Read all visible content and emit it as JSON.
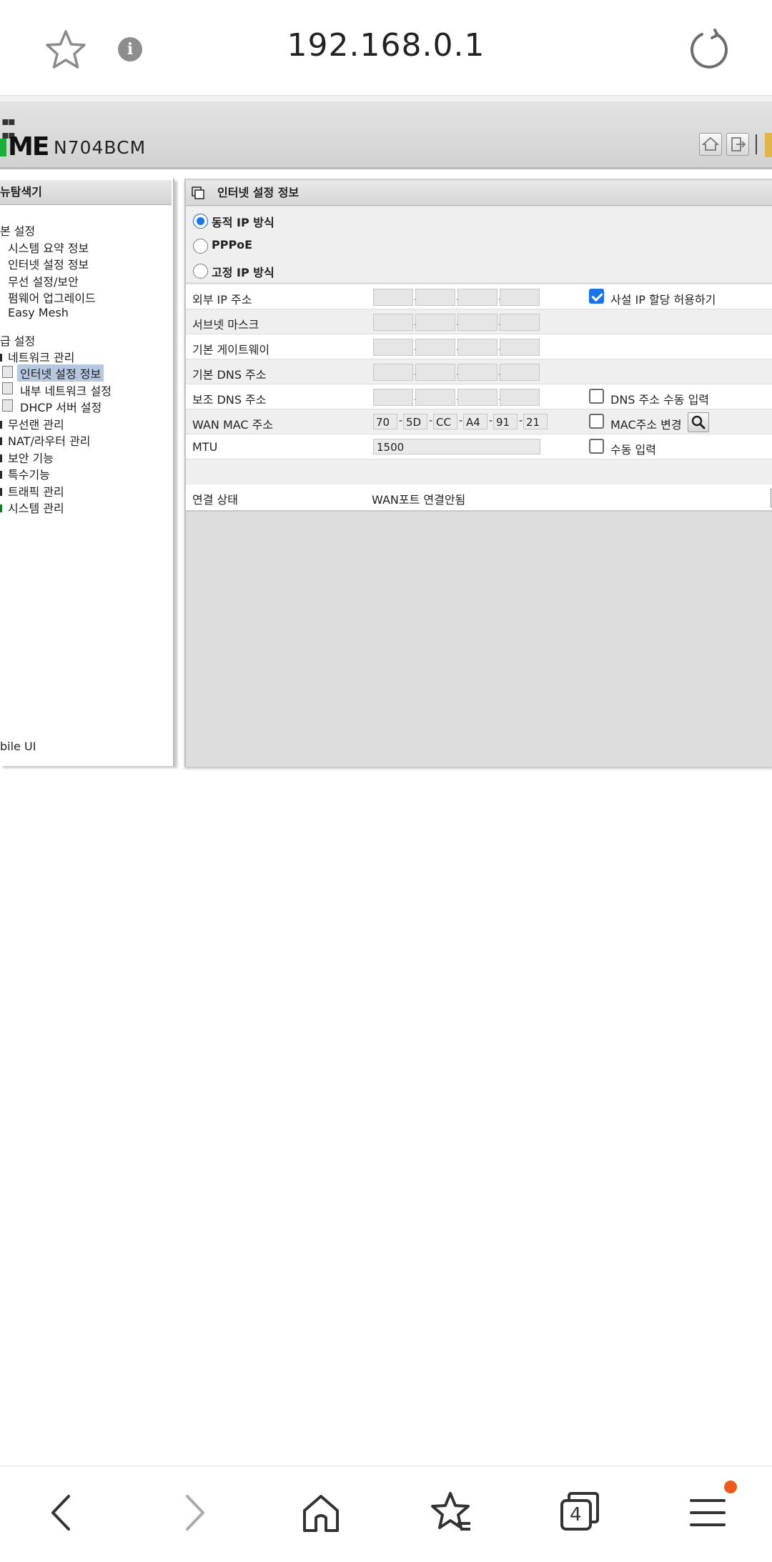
{
  "browser": {
    "url": "192.168.0.1",
    "tab_count": "4",
    "icons": [
      "star-icon",
      "info-icon",
      "reload-icon",
      "back-icon",
      "forward-icon",
      "home-icon",
      "bookmarks-icon",
      "tabs-icon",
      "menu-icon"
    ],
    "badge_color": "#ef5b1f"
  },
  "router": {
    "brand": "ME",
    "model": "N704BCM",
    "brand_accent": "#1cae3a"
  },
  "sidebar": {
    "title": "뉴탐색기",
    "basic_section": "본 설정",
    "basic_items": [
      "시스템 요약 정보",
      "인터넷 설정 정보",
      "무선 설정/보안",
      "펌웨어 업그레이드",
      "Easy Mesh"
    ],
    "advanced_section": "급 설정",
    "network_group": "네트워크 관리",
    "network_items": [
      "인터넷 설정 정보",
      "내부 네트워크 설정",
      "DHCP 서버 설정"
    ],
    "other_items": [
      "무선랜 관리",
      "NAT/라우터 관리",
      "보안 기능",
      "특수기능",
      "트래픽 관리",
      "시스템 관리"
    ],
    "footer": "bile UI",
    "selected": "인터넷 설정 정보"
  },
  "main": {
    "title": "인터넷 설정 정보",
    "radio_options": [
      {
        "label": "동적 IP 방식",
        "checked": true
      },
      {
        "label": "PPPoE",
        "checked": false
      },
      {
        "label": "고정 IP 방식",
        "checked": false
      }
    ],
    "fields": {
      "external_ip": {
        "label": "외부 IP 주소",
        "check_label": "사설 IP 할당 허용하기",
        "checked": true
      },
      "subnet": {
        "label": "서브넷 마스크"
      },
      "gateway": {
        "label": "기본 게이트웨이"
      },
      "dns1": {
        "label": "기본 DNS 주소"
      },
      "dns2": {
        "label": "보조 DNS 주소",
        "check_label": "DNS 주소 수동 입력",
        "checked": false
      },
      "wan_mac": {
        "label": "WAN MAC 주소",
        "octets": [
          "70",
          "5D",
          "CC",
          "A4",
          "91",
          "21"
        ],
        "check_label": "MAC주소 변경",
        "checked": false
      },
      "mtu": {
        "label": "MTU",
        "value": "1500",
        "check_label": "수동 입력",
        "checked": false
      }
    },
    "status": {
      "label": "연결 상태",
      "value": "WAN포트 연결안됨"
    }
  }
}
